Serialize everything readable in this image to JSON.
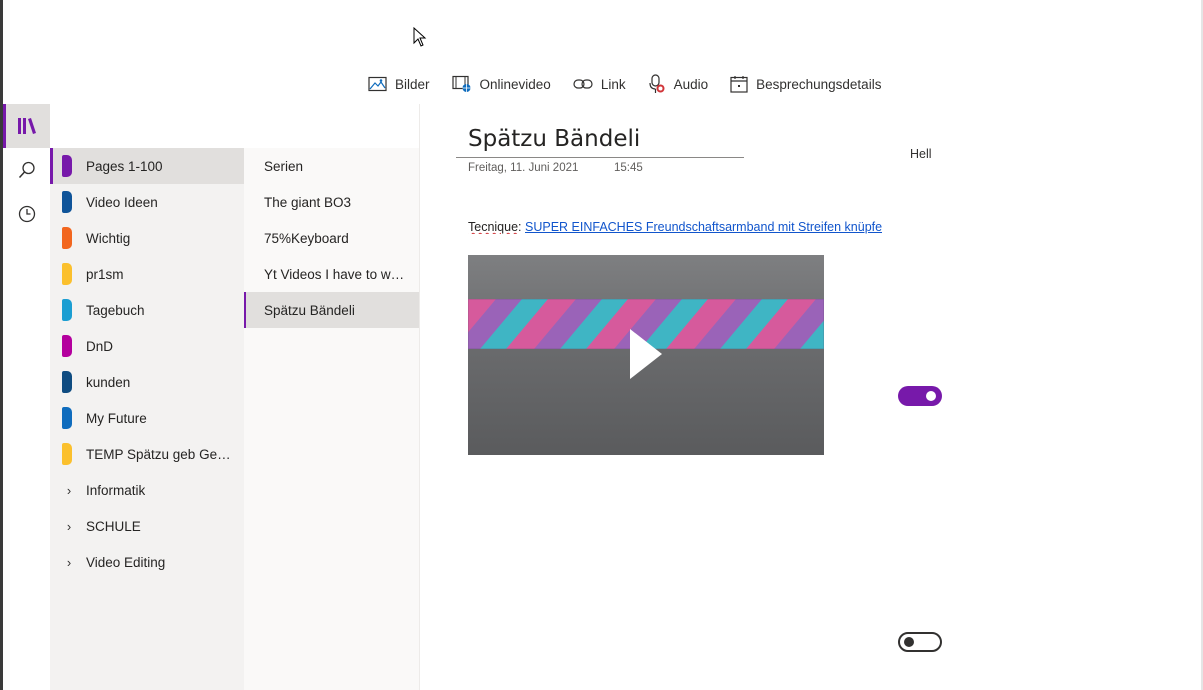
{
  "toolbar": {
    "items": [
      {
        "label": "Bilder",
        "icon": "picture-icon"
      },
      {
        "label": "Onlinevideo",
        "icon": "online-video-icon"
      },
      {
        "label": "Link",
        "icon": "link-icon"
      },
      {
        "label": "Audio",
        "icon": "microphone-icon"
      },
      {
        "label": "Besprechungsdetails",
        "icon": "calendar-icon"
      }
    ]
  },
  "rail": {
    "items": [
      {
        "icon": "notebooks-icon",
        "active": true
      },
      {
        "icon": "search-icon"
      },
      {
        "icon": "recent-clock-icon"
      }
    ]
  },
  "sections": [
    {
      "label": "Pages 1-100",
      "color": "#7719aa",
      "active": true
    },
    {
      "label": "Video Ideen",
      "color": "#0f5499"
    },
    {
      "label": "Wichtig",
      "color": "#f2661e"
    },
    {
      "label": "pr1sm",
      "color": "#fbc02d"
    },
    {
      "label": "Tagebuch",
      "color": "#1b9ed2"
    },
    {
      "label": "DnD",
      "color": "#b4009e"
    },
    {
      "label": "kunden",
      "color": "#0f4c81"
    },
    {
      "label": "My Future",
      "color": "#0f6cbd"
    },
    {
      "label": "TEMP Spätzu geb Gesc...",
      "color": "#fbc02d"
    }
  ],
  "section_groups": [
    {
      "label": "Informatik"
    },
    {
      "label": "SCHULE"
    },
    {
      "label": "Video Editing"
    }
  ],
  "pages": [
    {
      "label": "Serien"
    },
    {
      "label": "The giant BO3"
    },
    {
      "label": "75%Keyboard"
    },
    {
      "label": "Yt Videos I have to wat..."
    },
    {
      "label": "Spätzu Bändeli",
      "active": true
    }
  ],
  "page": {
    "title": "Spätzu Bändeli",
    "date": "Freitag, 11. Juni 2021",
    "time": "15:45",
    "hell_label": "Hell",
    "technique_label": "Tecnique",
    "technique_separator": ": ",
    "technique_link": "SUPER EINFACHES Freundschaftsarmband mit Streifen knüpfen"
  },
  "video": {
    "icon": "play-icon"
  },
  "toggles": [
    {
      "state": "on"
    },
    {
      "state": "off"
    }
  ],
  "colors": {
    "accent": "#7719aa",
    "link": "#1155cc"
  }
}
